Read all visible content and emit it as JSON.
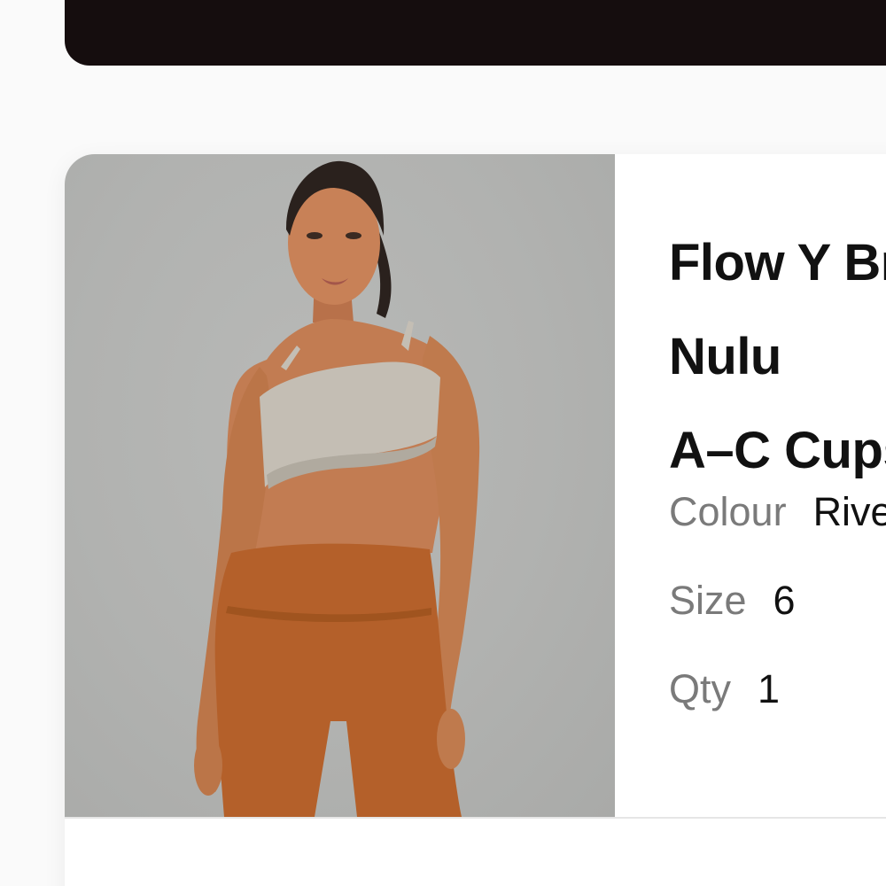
{
  "product": {
    "name_line1": "Flow Y Bra Nulu",
    "name_line2": "A–C Cups",
    "attributes": {
      "colour_label": "Colour",
      "colour_value": "Riverstone",
      "size_label": "Size",
      "size_value": "6",
      "qty_label": "Qty",
      "qty_value": "1"
    },
    "image_description": "model wearing sports bra and shorts"
  },
  "colors": {
    "header": "#150d0e",
    "image_background": "#b1b2b0",
    "bra": "#c4beb4",
    "shorts": "#b4602a",
    "skin": "#c27c52"
  }
}
